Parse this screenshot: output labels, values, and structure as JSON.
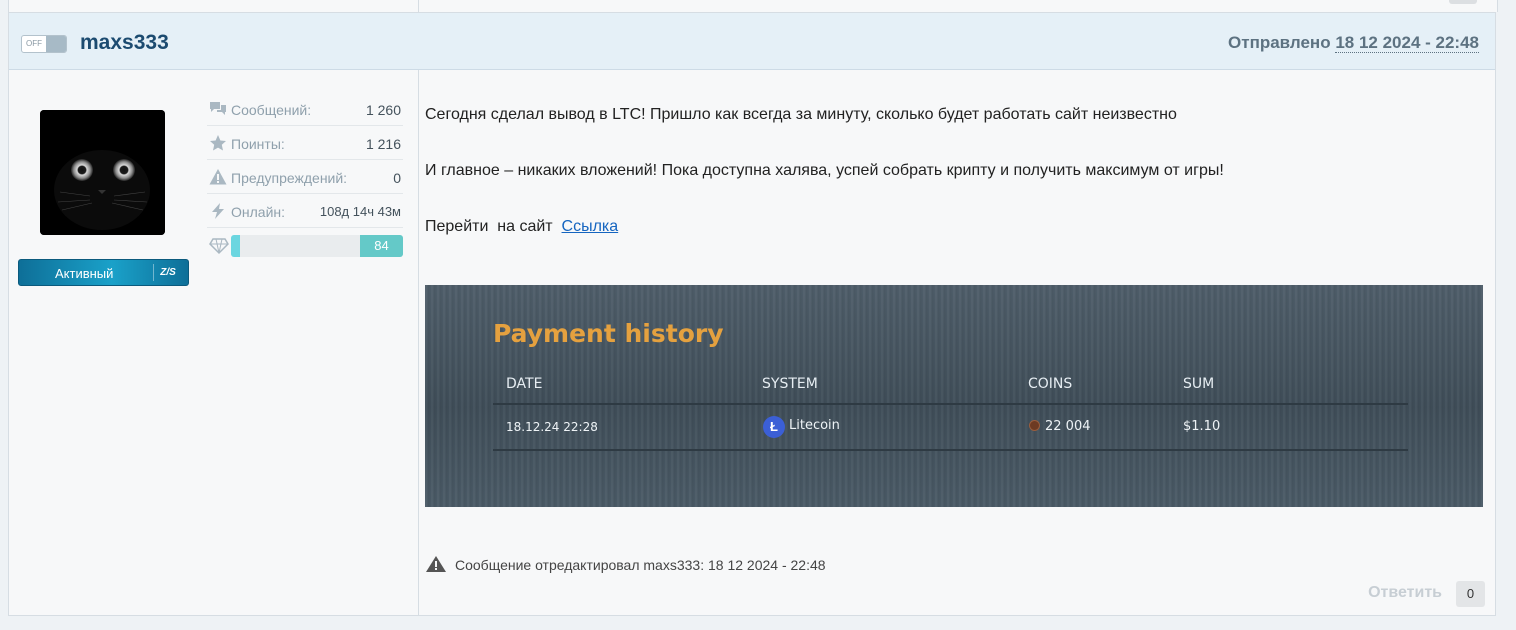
{
  "post": {
    "status_toggle": "OFF",
    "username": "maxs333",
    "sent_label": "Отправлено",
    "sent_date": "18 12 2024 - 22:48",
    "rank_label": "Активный",
    "rank_logo": "Z/S",
    "stats": [
      {
        "icon": "messages-icon",
        "label": "Сообщений:",
        "value": "1 260"
      },
      {
        "icon": "star-icon",
        "label": "Поинты:",
        "value": "1 216"
      },
      {
        "icon": "warning-icon",
        "label": "Предупреждений:",
        "value": "0"
      },
      {
        "icon": "lightning-icon",
        "label": "Онлайн:",
        "value": "108д 14ч 43м"
      }
    ],
    "reputation": {
      "icon": "diamond-icon",
      "value": "84",
      "fill_fraction": 0.05
    },
    "body": {
      "line1": "Сегодня сделал вывод в LTC! Пришло как всегда за минуту, сколько будет работать сайт неизвестно",
      "line2": "И главное – никаких вложений! Пока доступна халява, успей собрать крипту и получить максимум от игры!",
      "line3_text": "Перейти  на сайт",
      "line3_link": "Ссылка"
    },
    "screenshot": {
      "title": "Payment history",
      "columns": [
        "DATE",
        "SYSTEM",
        "COINS",
        "SUM"
      ],
      "row": {
        "date": "18.12.24 22:28",
        "system_icon": "Ł",
        "system": "Litecoin",
        "coins": "22 004",
        "sum": "$1.10"
      }
    },
    "edited_note": "Сообщение отредактировал maxs333: 18 12 2024 - 22:48",
    "reply_label": "Ответить",
    "reply_count": "0"
  },
  "colors": {
    "accent": "#1c4b70",
    "header_bg": "#e5f0f7",
    "screenshot_title": "#e5a13f",
    "rep_fill": "#6bd6e0"
  }
}
